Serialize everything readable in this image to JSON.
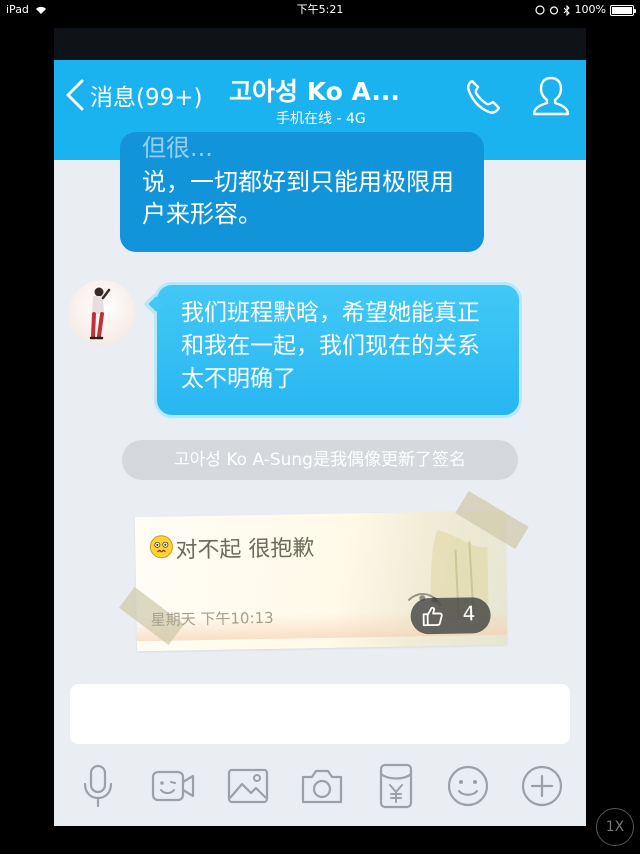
{
  "device_status": {
    "device": "iPad",
    "time": "下午5:21",
    "battery": "100%"
  },
  "header": {
    "back_label": "消息(99+)",
    "title": "고아성 Ko A...",
    "subtitle": "手机在线 - 4G"
  },
  "messages": {
    "outgoing_partial_line": "但很...",
    "outgoing_text": "说，一切都好到只能用极限用户来形容。",
    "incoming_text": "我们班程默晗，希望她能真正和我在一起，我们现在的关系太不明确了"
  },
  "system_notice": "고아성 Ko A-Sung是我偶像更新了签名",
  "signature_card": {
    "text": "对不起 很抱歉",
    "time": "星期天 下午10:13",
    "like_count": "4"
  },
  "input": {
    "placeholder": ""
  },
  "toolbar": {
    "icons": [
      "microphone-icon",
      "video-call-icon",
      "photo-icon",
      "camera-icon",
      "red-packet-icon",
      "emoji-icon",
      "plus-icon"
    ]
  },
  "playback_speed": "1X"
}
